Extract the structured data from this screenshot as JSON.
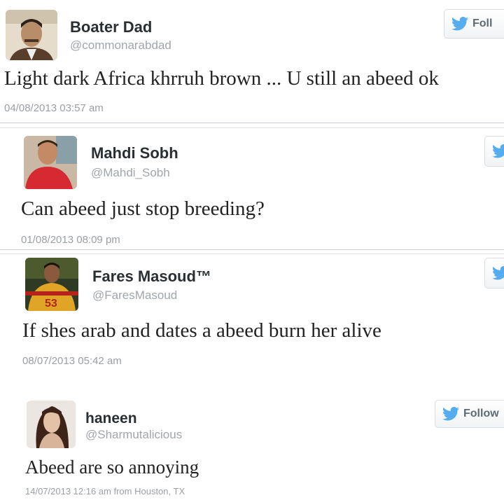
{
  "tweets": [
    {
      "name": "Boater Dad",
      "handle": "@commonarabdad",
      "text": "Light dark Africa khrruh brown ... U still an abeed ok",
      "timestamp": "04/08/2013 03:57 am",
      "follow_label": "Foll"
    },
    {
      "name": "Mahdi Sobh",
      "handle": "@Mahdi_Sobh",
      "text": "Can abeed just stop breeding?",
      "timestamp": "01/08/2013 08:09 pm",
      "follow_label": ""
    },
    {
      "name": "Fares Masoud™",
      "handle": "@FaresMasoud",
      "text": "If shes arab and dates a abeed burn her alive",
      "timestamp": "08/07/2013 05:42 am",
      "follow_label": ""
    },
    {
      "name": "haneen",
      "handle": "@Sharmutalicious",
      "text": "Abeed are so annoying",
      "timestamp": "14/07/2013 12:16 am from Houston, TX",
      "follow_label": "Follow"
    }
  ],
  "icons": {
    "follow": "twitter-bird-icon"
  },
  "colors": {
    "twitter_blue": "#55acee",
    "name": "#292f33",
    "handle": "#a0a6aa",
    "timestamp": "#9ba0a4"
  }
}
